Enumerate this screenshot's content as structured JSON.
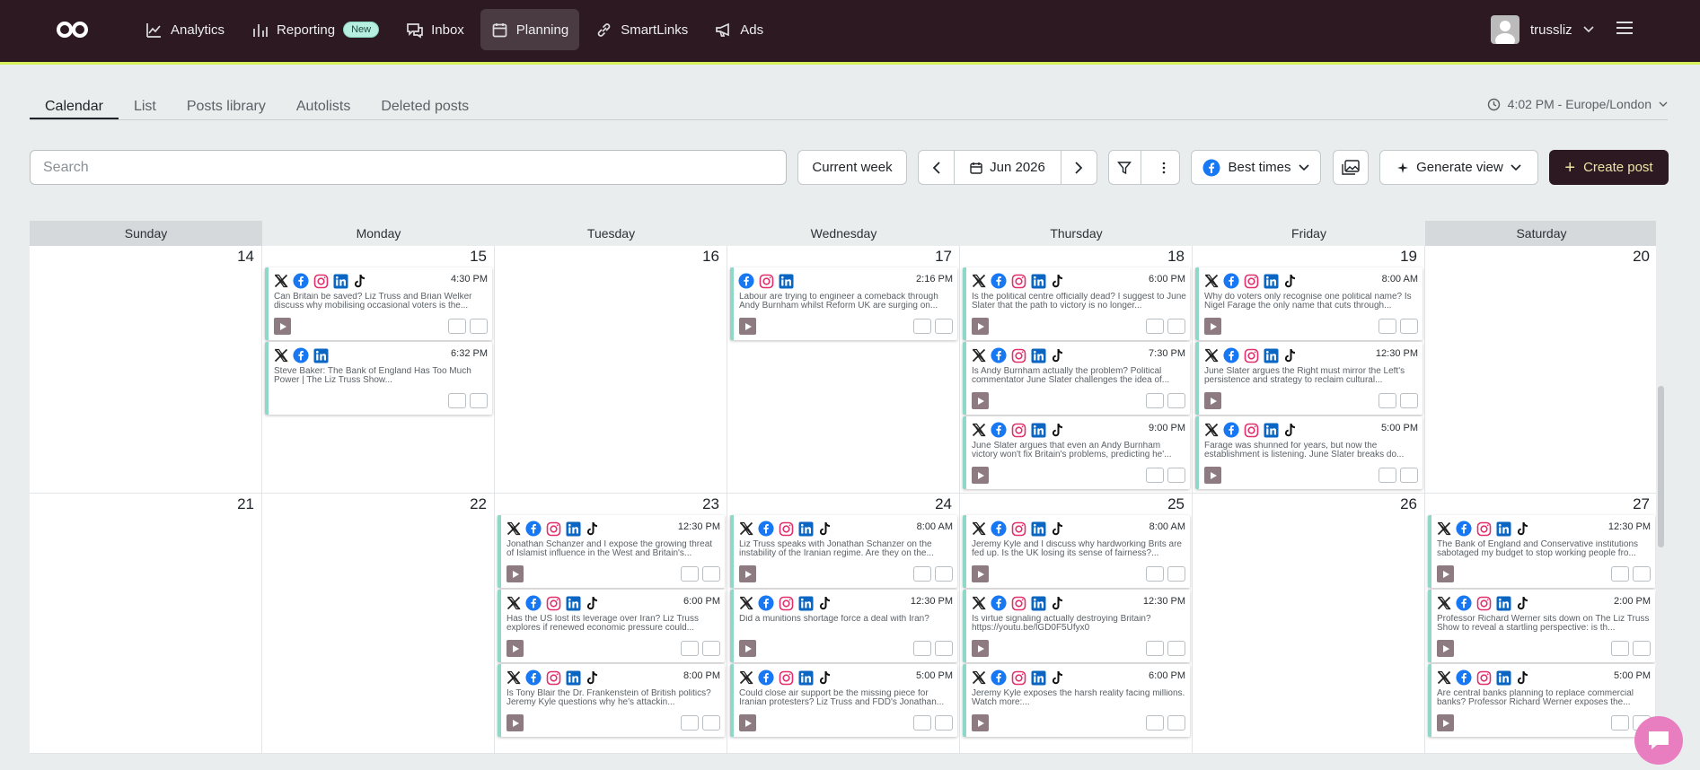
{
  "nav": {
    "items": [
      {
        "label": "Analytics",
        "icon": "chart-line-icon"
      },
      {
        "label": "Reporting",
        "icon": "bar-chart-icon",
        "badge": "New"
      },
      {
        "label": "Inbox",
        "icon": "chat-bubbles-icon"
      },
      {
        "label": "Planning",
        "icon": "calendar-icon",
        "active": true
      },
      {
        "label": "SmartLinks",
        "icon": "link-icon"
      },
      {
        "label": "Ads",
        "icon": "megaphone-icon"
      }
    ],
    "username": "trussliz"
  },
  "tabs": [
    "Calendar",
    "List",
    "Posts library",
    "Autolists",
    "Deleted posts"
  ],
  "timezone": "4:02 PM - Europe/London",
  "toolbar": {
    "search_placeholder": "Search",
    "current_week": "Current week",
    "month": "Jun 2026",
    "best_times": "Best times",
    "generate_view": "Generate view",
    "create_post": "Create post"
  },
  "days": [
    "Sunday",
    "Monday",
    "Tuesday",
    "Wednesday",
    "Thursday",
    "Friday",
    "Saturday"
  ],
  "weeks": [
    {
      "dates": [
        "14",
        "15",
        "16",
        "17",
        "18",
        "19",
        "20"
      ],
      "cells": [
        [],
        [
          {
            "time": "4:30 PM",
            "icons": [
              "x",
              "fb",
              "ig",
              "li",
              "tt"
            ],
            "text": "Can Britain be saved? Liz Truss and Brian Welker discuss why mobilising occasional voters is the...",
            "thumb": true
          },
          {
            "time": "6:32 PM",
            "icons": [
              "x",
              "fb",
              "li"
            ],
            "text": "Steve Baker: The Bank of England Has Too Much Power | The Liz Truss Show...",
            "thumb": false
          }
        ],
        [],
        [
          {
            "time": "2:16 PM",
            "icons": [
              "fb",
              "ig",
              "li"
            ],
            "text": "Labour are trying to engineer a comeback through Andy Burnham whilst Reform UK are surging on...",
            "thumb": true
          }
        ],
        [
          {
            "time": "6:00 PM",
            "icons": [
              "x",
              "fb",
              "ig",
              "li",
              "tt"
            ],
            "text": "Is the political centre officially dead? I suggest to June Slater that the path to victory is no longer...",
            "thumb": true
          },
          {
            "time": "7:30 PM",
            "icons": [
              "x",
              "fb",
              "ig",
              "li",
              "tt"
            ],
            "text": "Is Andy Burnham actually the problem? Political commentator June Slater challenges the idea of...",
            "thumb": true
          },
          {
            "time": "9:00 PM",
            "icons": [
              "x",
              "fb",
              "ig",
              "li",
              "tt"
            ],
            "text": "June Slater argues that even an Andy Burnham victory won't fix Britain's problems, predicting he'...",
            "thumb": true
          }
        ],
        [
          {
            "time": "8:00 AM",
            "icons": [
              "x",
              "fb",
              "ig",
              "li",
              "tt"
            ],
            "text": "Why do voters only recognise one political name? Is Nigel Farage the only name that cuts through...",
            "thumb": true
          },
          {
            "time": "12:30 PM",
            "icons": [
              "x",
              "fb",
              "ig",
              "li",
              "tt"
            ],
            "text": "June Slater argues the Right must mirror the Left's persistence and strategy to reclaim cultural...",
            "thumb": true
          },
          {
            "time": "5:00 PM",
            "icons": [
              "x",
              "fb",
              "ig",
              "li",
              "tt"
            ],
            "text": "Farage was shunned for years, but now the establishment is listening. June Slater breaks do...",
            "thumb": true
          }
        ],
        []
      ]
    },
    {
      "dates": [
        "21",
        "22",
        "23",
        "24",
        "25",
        "26",
        "27"
      ],
      "cells": [
        [],
        [],
        [
          {
            "time": "12:30 PM",
            "icons": [
              "x",
              "fb",
              "ig",
              "li",
              "tt"
            ],
            "text": "Jonathan Schanzer and I expose the growing threat of Islamist influence in the West and Britain's...",
            "thumb": true
          },
          {
            "time": "6:00 PM",
            "icons": [
              "x",
              "fb",
              "ig",
              "li",
              "tt"
            ],
            "text": "Has the US lost its leverage over Iran? Liz Truss explores if renewed economic pressure could...",
            "thumb": true
          },
          {
            "time": "8:00 PM",
            "icons": [
              "x",
              "fb",
              "ig",
              "li",
              "tt"
            ],
            "text": "Is Tony Blair the Dr. Frankenstein of British politics? Jeremy Kyle questions why he's attackin...",
            "thumb": true
          }
        ],
        [
          {
            "time": "8:00 AM",
            "icons": [
              "x",
              "fb",
              "ig",
              "li",
              "tt"
            ],
            "text": "Liz Truss speaks with Jonathan Schanzer on the instability of the Iranian regime. Are they on the...",
            "thumb": true
          },
          {
            "time": "12:30 PM",
            "icons": [
              "x",
              "fb",
              "ig",
              "li",
              "tt"
            ],
            "text": "Did a munitions shortage force a deal with Iran?",
            "thumb": true
          },
          {
            "time": "5:00 PM",
            "icons": [
              "x",
              "fb",
              "ig",
              "li",
              "tt"
            ],
            "text": "Could close air support be the missing piece for Iranian protesters? Liz Truss and FDD's Jonathan...",
            "thumb": true
          }
        ],
        [
          {
            "time": "8:00 AM",
            "icons": [
              "x",
              "fb",
              "ig",
              "li",
              "tt"
            ],
            "text": "Jeremy Kyle and I discuss why hardworking Brits are fed up. Is the UK losing its sense of fairness?...",
            "thumb": true
          },
          {
            "time": "12:30 PM",
            "icons": [
              "x",
              "fb",
              "ig",
              "li",
              "tt"
            ],
            "text": "Is virtue signaling actually destroying Britain? https://youtu.be/lGD0F5Ufyx0",
            "thumb": true
          },
          {
            "time": "6:00 PM",
            "icons": [
              "x",
              "fb",
              "ig",
              "li",
              "tt"
            ],
            "text": "Jeremy Kyle exposes the harsh reality facing millions. Watch more:...",
            "thumb": true
          }
        ],
        [],
        [
          {
            "time": "12:30 PM",
            "icons": [
              "x",
              "fb",
              "ig",
              "li",
              "tt"
            ],
            "text": "The Bank of England and Conservative institutions sabotaged my budget to stop working people fro...",
            "thumb": true
          },
          {
            "time": "2:00 PM",
            "icons": [
              "x",
              "fb",
              "ig",
              "li",
              "tt"
            ],
            "text": "Professor Richard Werner sits down on The Liz Truss Show to reveal a startling perspective: is th...",
            "thumb": true
          },
          {
            "time": "5:00 PM",
            "icons": [
              "x",
              "fb",
              "ig",
              "li",
              "tt"
            ],
            "text": "Are central banks planning to replace commercial banks? Professor Richard Werner exposes the...",
            "thumb": true
          }
        ]
      ]
    }
  ],
  "colors": {
    "nav_bg": "#2c1921",
    "accent_line": "#d6f05b",
    "post_border": "#8fd8c8",
    "x": "#222222",
    "fb": "#1877f2",
    "ig": "#e1306c",
    "li": "#0a66c2",
    "tt": "#111111"
  }
}
